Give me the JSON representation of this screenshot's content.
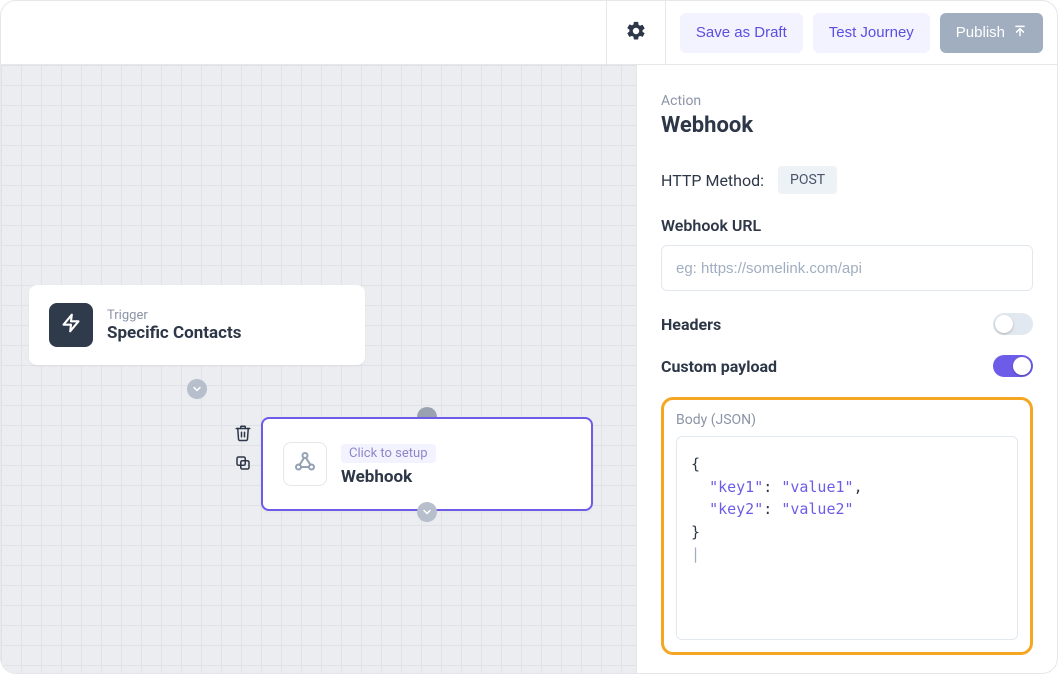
{
  "header": {
    "save_draft": "Save as Draft",
    "test_journey": "Test Journey",
    "publish": "Publish"
  },
  "canvas": {
    "trigger": {
      "eyebrow": "Trigger",
      "title": "Specific Contacts"
    },
    "action": {
      "eyebrow": "Click to setup",
      "title": "Webhook"
    }
  },
  "panel": {
    "eyebrow": "Action",
    "title": "Webhook",
    "http_method_label": "HTTP Method:",
    "http_method_value": "POST",
    "url_label": "Webhook URL",
    "url_placeholder": "eg: https://somelink.com/api",
    "url_value": "",
    "headers_label": "Headers",
    "headers_enabled": false,
    "custom_payload_label": "Custom payload",
    "custom_payload_enabled": true,
    "body_label": "Body (JSON)",
    "body_json": {
      "key1": "value1",
      "key2": "value2"
    }
  }
}
